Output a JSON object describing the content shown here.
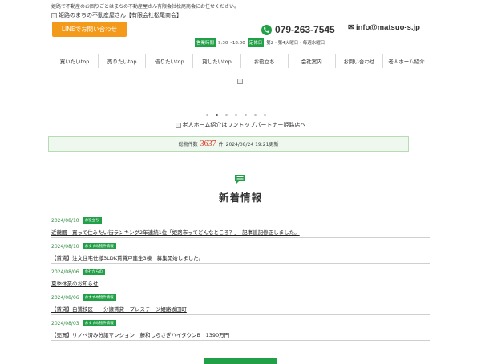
{
  "header": {
    "tagline": "姫路で不動産のお困りごとはまちの不動産屋さん有限会社松尾商会にお任せください。",
    "logo_alt": "姫路のまちの不動産屋さん【有限会社松尾商会】",
    "line_button": "LINEでお問い合わせ",
    "phone": "079-263-7545",
    "email": "info@matsuo-s.jp",
    "hours_badge": "営業時間",
    "hours": "9:30～18:00",
    "closed_badge": "定休日",
    "closed": "第2・第4火曜日・毎週水曜日"
  },
  "nav": {
    "items": [
      "買いたいtop",
      "売りたいtop",
      "借りたいtop",
      "貸したいtop",
      "お役立ち",
      "会社案内",
      "お問い合わせ",
      "老人ホーム紹介"
    ]
  },
  "banner": {
    "text": "老人ホーム紹介はワントップパートナー姫路店へ"
  },
  "stats": {
    "label": "総物件数",
    "count": "3637",
    "unit": "件",
    "updated": "2024/08/24 19:21更新"
  },
  "news": {
    "title": "新着情報",
    "items": [
      {
        "date": "2024/08/10",
        "category": "お役立ち",
        "text": "近畿圏　買って住みたい街ランキング2年連続1位「姫路市ってどんなところ？」　記事追記修正しました。"
      },
      {
        "date": "2024/08/10",
        "category": "おすすめ物件情報",
        "text": "【賃貸】注文住宅仕様3LDK賃貸戸建全3棟　募集開始しました。"
      },
      {
        "date": "2024/08/06",
        "category": "会社からの",
        "text": "夏季休業のお知らせ"
      },
      {
        "date": "2024/08/06",
        "category": "おすすめ物件情報",
        "text": "【賃貸】白鷺校区　　分譲賃貸　プレステージ姫路坂田町"
      },
      {
        "date": "2024/08/03",
        "category": "おすすめ物件情報",
        "text": "【売買】リノベ済み分譲マンション　藤和しらさぎハイタウンB　1390万円"
      }
    ]
  },
  "colors": {
    "accent_green": "#22a048",
    "line_orange": "#f39a1a",
    "count_red": "#d23a2a"
  }
}
